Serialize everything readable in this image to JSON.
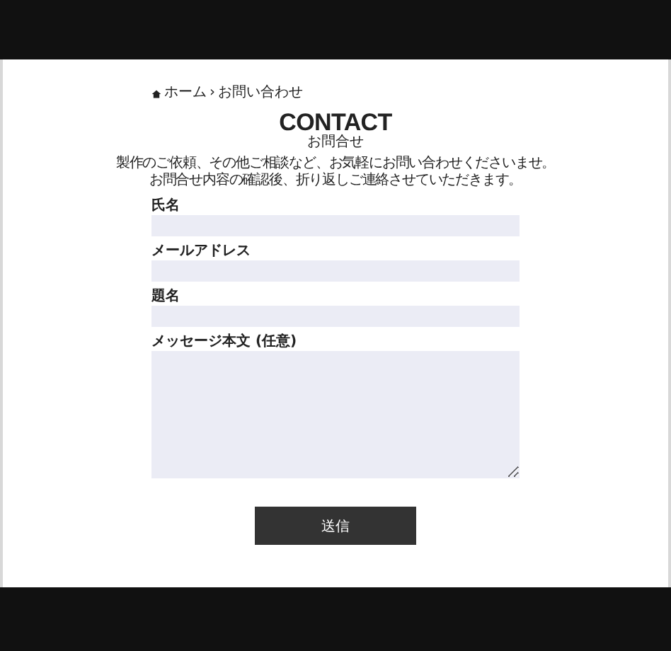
{
  "breadcrumb": {
    "home": "ホーム",
    "separator": "›",
    "current": "お問い合わせ"
  },
  "heading": {
    "title": "CONTACT",
    "subtitle": "お問合せ"
  },
  "intro": [
    "製作のご依頼、その他ご相談など、お気軽にお問い合わせくださいませ。",
    "お問合せ内容の確認後、折り返しご連絡させていただきます。"
  ],
  "fields": [
    {
      "label": "氏名",
      "kind": "input"
    },
    {
      "label": "メールアドレス",
      "kind": "input"
    },
    {
      "label": "題名",
      "kind": "input"
    },
    {
      "label": "メッセージ本文 (任意)",
      "kind": "textarea"
    }
  ],
  "submit": "送信"
}
